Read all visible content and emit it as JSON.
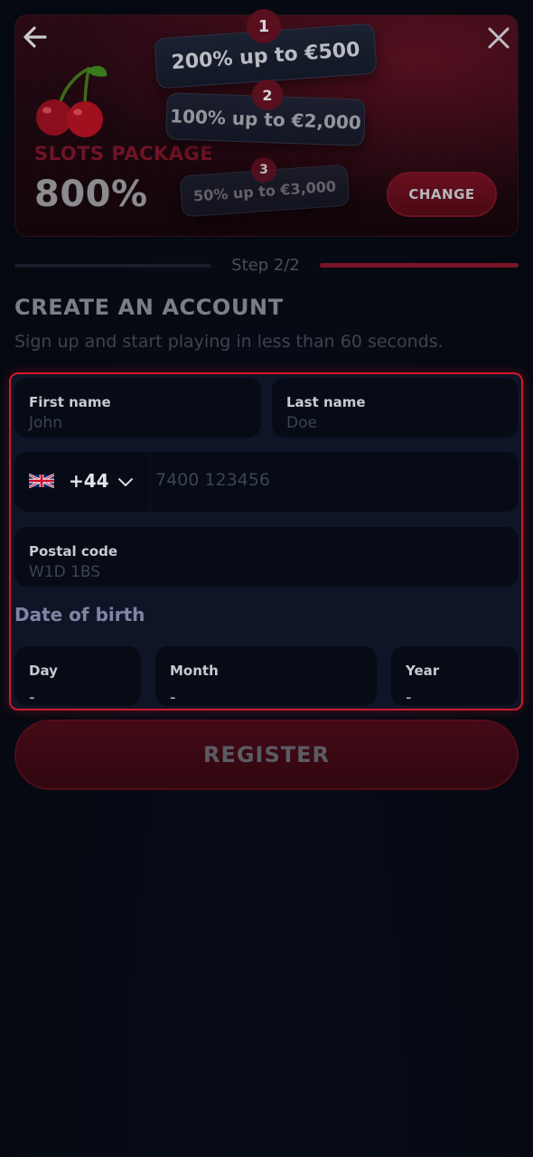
{
  "banner": {
    "package_label": "SLOTS PACKAGE",
    "package_percent": "800%",
    "change_label": "CHANGE",
    "tiers": [
      {
        "number": "1",
        "text": "200% up to €500"
      },
      {
        "number": "2",
        "text": "100% up to €2,000"
      },
      {
        "number": "3",
        "text": "50% up to €3,000"
      }
    ]
  },
  "step": {
    "text": "Step 2/2"
  },
  "heading": {
    "title": "CREATE AN ACCOUNT",
    "subtitle": "Sign up and start playing in less than 60 seconds."
  },
  "form": {
    "first_name": {
      "label": "First name",
      "placeholder": "John"
    },
    "last_name": {
      "label": "Last name",
      "placeholder": "Doe"
    },
    "phone": {
      "country_code": "+44",
      "placeholder": "7400 123456",
      "flag": "uk-flag-icon"
    },
    "postal_code": {
      "label": "Postal code",
      "placeholder": "W1D 1BS"
    },
    "dob": {
      "label": "Date of birth",
      "day": {
        "label": "Day",
        "value": "-"
      },
      "month": {
        "label": "Month",
        "value": "-"
      },
      "year": {
        "label": "Year",
        "value": "-"
      }
    }
  },
  "register_label": "REGISTER",
  "colors": {
    "accent_red": "#d2172c",
    "field_bg": "#060b16",
    "form_bg": "#0f1526"
  }
}
